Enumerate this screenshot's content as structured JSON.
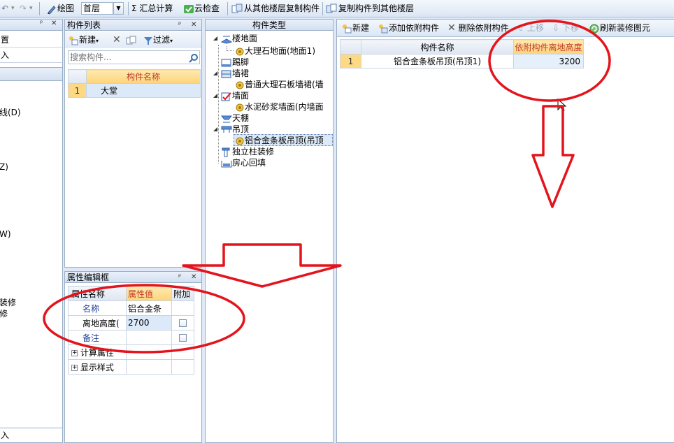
{
  "toolbar": {
    "undo_glyph": "↶",
    "redo_glyph": "↷",
    "draw_label": "绘图",
    "floor_value": "首层",
    "sum_label": "汇总计算",
    "cloud_check_label": "云检查",
    "copy_from_label": "从其他楼层复制构件",
    "copy_to_label": "复制构件到其他楼层"
  },
  "left_panel": {
    "row1": "置",
    "row2": "入",
    "items": [
      "线(D)",
      "Z)",
      "W)",
      "装修",
      "修"
    ],
    "bottom": "入"
  },
  "component_list": {
    "title": "构件列表",
    "new_label": "新建",
    "filter_label": "过滤",
    "search_placeholder": "搜索构件...",
    "column_header": "构件名称",
    "rows": [
      {
        "num": "1",
        "name": "大堂"
      }
    ]
  },
  "property_editor": {
    "title": "属性编辑框",
    "headers": [
      "属性名称",
      "属性值",
      "附加"
    ],
    "rows": [
      {
        "name": "名称",
        "value": "铝合金条"
      },
      {
        "name": "离地高度(",
        "value": "2700"
      },
      {
        "name": "备注",
        "value": ""
      },
      {
        "name": "计算属性",
        "value": ""
      },
      {
        "name": "显示样式",
        "value": ""
      }
    ]
  },
  "component_types": {
    "title": "构件类型",
    "items": [
      {
        "label": "楼地面",
        "level": 0
      },
      {
        "label": "大理石地面(地面1)",
        "level": 1
      },
      {
        "label": "踢脚",
        "level": 0
      },
      {
        "label": "墙裙",
        "level": 0
      },
      {
        "label": "普通大理石板墙裙(墙",
        "level": 1
      },
      {
        "label": "墙面",
        "level": 0
      },
      {
        "label": "水泥砂浆墙面(内墙面",
        "level": 1
      },
      {
        "label": "天棚",
        "level": 0
      },
      {
        "label": "吊顶",
        "level": 0
      },
      {
        "label": "铝合金条板吊顶(吊顶",
        "level": 1
      },
      {
        "label": "独立柱装修",
        "level": 0
      },
      {
        "label": "房心回填",
        "level": 0
      }
    ]
  },
  "attached_components": {
    "toolbar": {
      "new_label": "新建",
      "add_label": "添加依附构件",
      "delete_label": "删除依附构件",
      "up_label": "上移",
      "down_label": "下移",
      "refresh_label": "刷新装修图元"
    },
    "headers": [
      "构件名称",
      "依附构件离地高度"
    ],
    "rows": [
      {
        "num": "1",
        "name": "铝合金条板吊顶(吊顶1)",
        "height": "3200"
      }
    ]
  },
  "colors": {
    "annotation_red": "#e3141c",
    "header_orange": "#fdd47a",
    "header_text_red": "#c0392b"
  }
}
